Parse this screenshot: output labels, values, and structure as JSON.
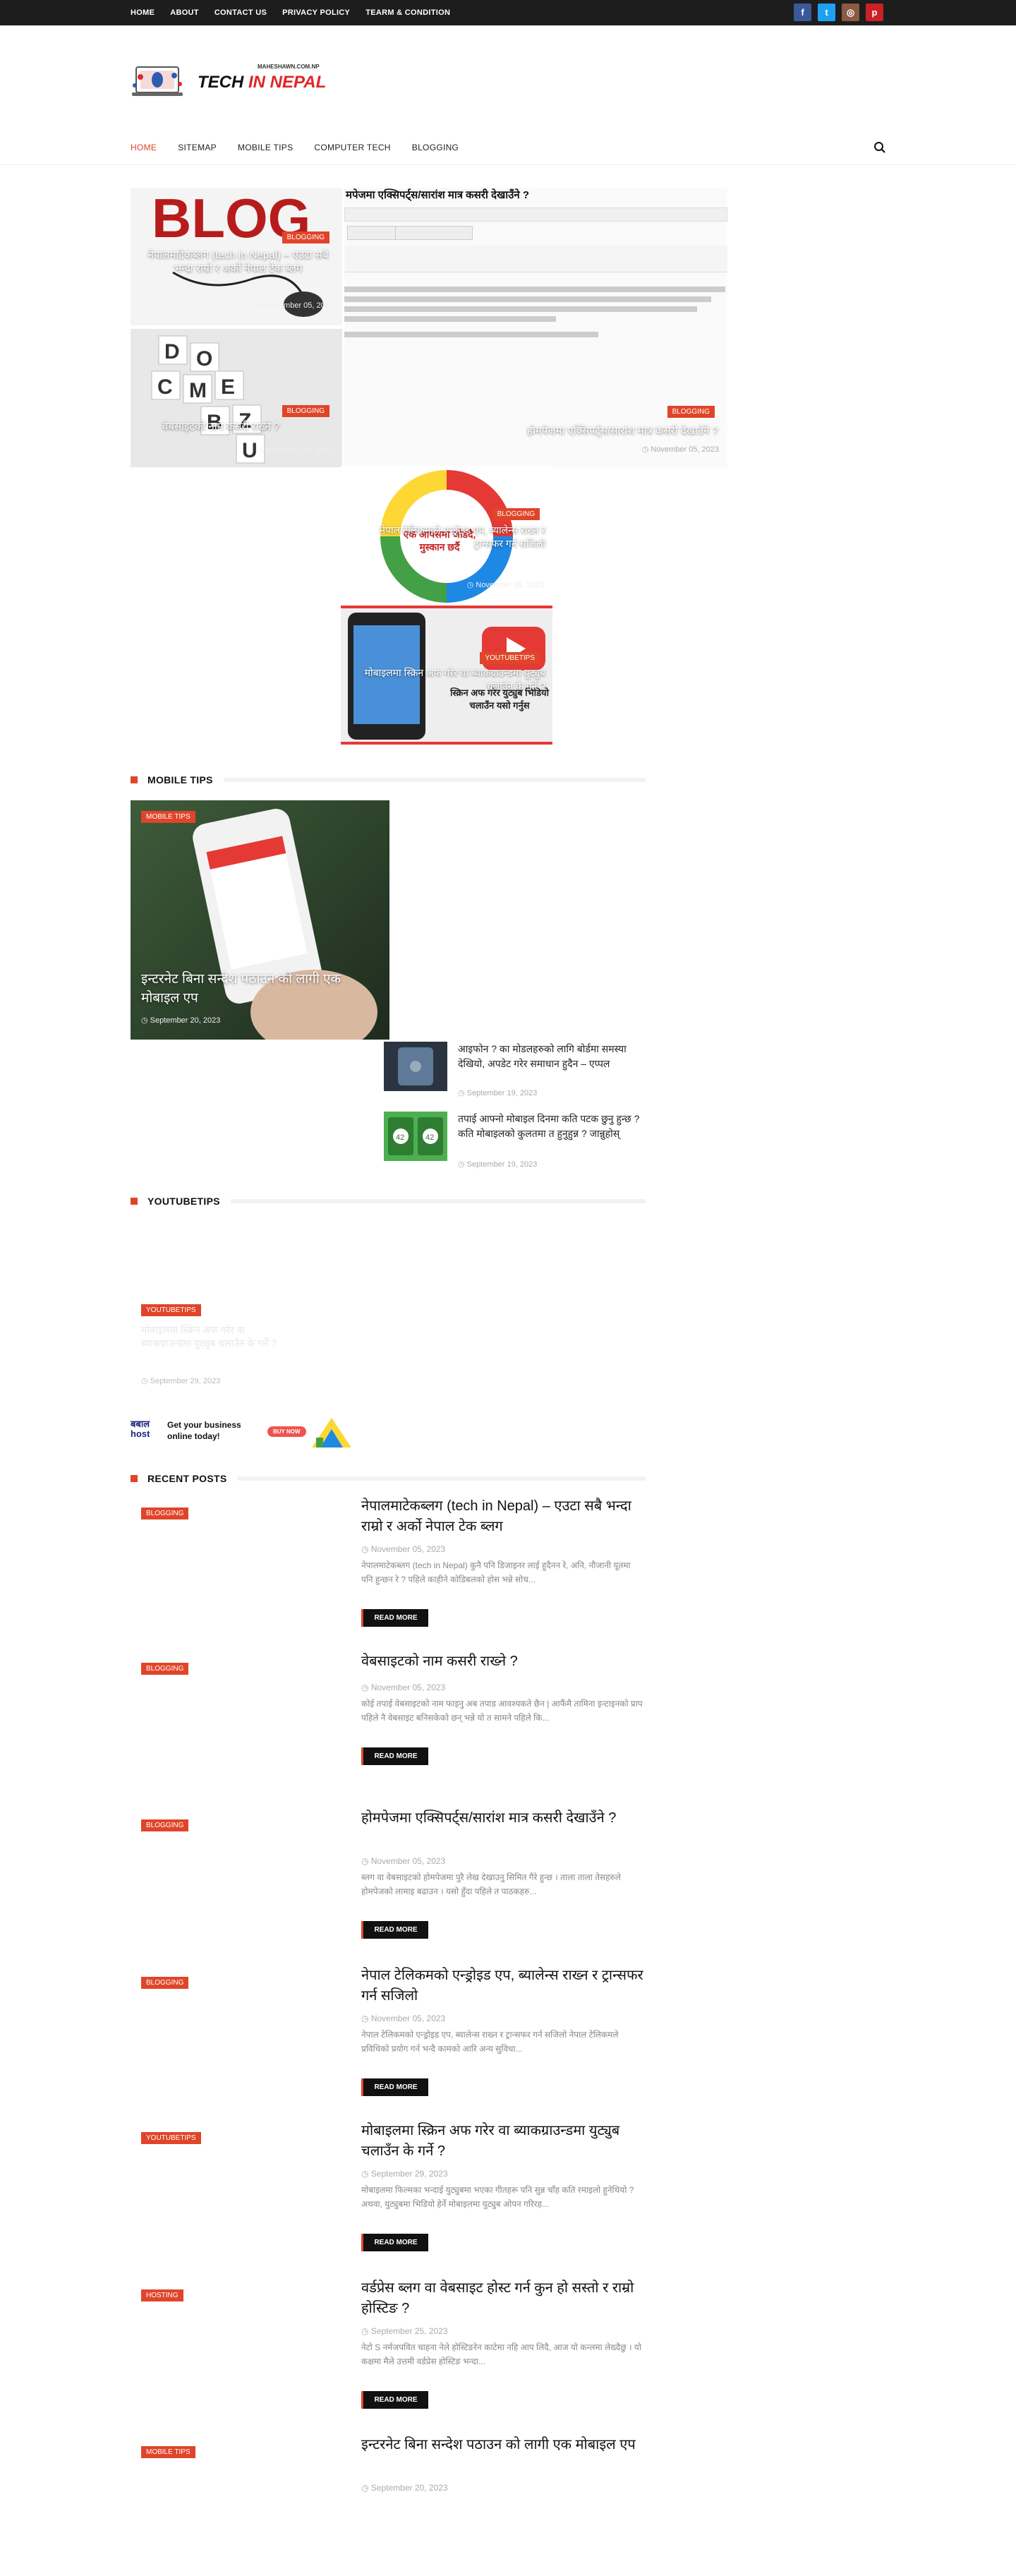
{
  "topbar": {
    "links": [
      "HOME",
      "ABOUT",
      "CONTACT US",
      "PRIVACY POLICY",
      "TEARM & CONDITION"
    ],
    "social": [
      {
        "name": "facebook-icon",
        "glyph": "f",
        "color": "#3b5998"
      },
      {
        "name": "twitter-icon",
        "glyph": "t",
        "color": "#1da1f2"
      },
      {
        "name": "instagram-icon",
        "glyph": "◎",
        "color": "#8a5a44"
      },
      {
        "name": "pinterest-icon",
        "glyph": "p",
        "color": "#cb2027"
      }
    ]
  },
  "logo": {
    "pre": "TECH ",
    "accent": "IN NEPAL",
    "sub": "MAHESHAWN.COM.NP"
  },
  "mainnav": {
    "items": [
      "HOME",
      "SITEMAP",
      "MOBILE TIPS",
      "COMPUTER TECH",
      "BLOGGING"
    ],
    "active": 0
  },
  "featured": [
    {
      "cat": "BLOGGING",
      "title": "नेपालमाटेकब्लग (tech in Nepal) – एउटा सबै भन्दा राम्रो र अर्को नेपाल टेक ब्लग",
      "date": "November 05, 2023"
    },
    {
      "cat": "BLOGGING",
      "title": "वेबसाइटको नाम कसरी राख्ने ?",
      "date": "November 05, 2023"
    },
    {
      "cat": "BLOGGING",
      "title": "होमपेजमा एक्सिपर्ट्स/सारांश मात्र कसरी देखाउँने ?",
      "date": "November 05, 2023",
      "shot_heading": "मपेजमा एक्सिपर्ट्स/सारांश मात्र कसरी देखाउँने ?"
    },
    {
      "cat": "BLOGGING",
      "title": "नेपाल टेलिकमको एन्ड्रोइड एप, ब्यालेन्स राख्न र ट्रान्सफर गर्न सजिलो",
      "date": "November 05, 2023",
      "img_text": "एक आपसमा जोडदै, मुस्कान छर्दै"
    },
    {
      "cat": "YOUTUBETIPS",
      "title": "मोबाइलमा स्क्रिन अफ गरेर वा ब्याकग्राउन्डमा युट्युब चलाउँन के गर्ने ?",
      "date": "September 29, 2023",
      "img_text": "स्क्रिन अफ गरेर युट्युब भिडियो चलाउँन यसो गर्नुस"
    }
  ],
  "mobiletips": {
    "heading": "MOBILE TIPS",
    "main": {
      "cat": "MOBILE TIPS",
      "title": "इन्टरनेट बिना सन्देश पठाउन को लागी एक मोबाइल एप",
      "date": "September 20, 2023"
    },
    "side": [
      {
        "title": "आइफोन ? का मोडलहरुको लागि बोर्डमा समस्या देखियो, अपडेट गरेर समाधान हुदैन – एप्पल",
        "date": "September 19, 2023"
      },
      {
        "title": "तपाई आफ्नो मोबाइल दिनमा कति पटक छुनु हुन्छ ? कति मोबाइलको कुलतमा त हुनुहुन्न ? जान्नुहोस्",
        "date": "September 19, 2023"
      }
    ]
  },
  "youtubetips": {
    "heading": "YOUTUBETIPS",
    "main": {
      "cat": "YOUTUBETIPS",
      "title": "मोबाइलमा स्क्रिन अफ गरेर वा ब्याकग्राउन्डमा युट्युब चलाउँन के गर्ने ?",
      "date": "September 29, 2023"
    }
  },
  "ad": {
    "brand": "बबाल host",
    "line1": "Get your business",
    "line2": "online today!",
    "btn": "BUY NOW"
  },
  "recent": {
    "heading": "RECENT POSTS",
    "read_more": "READ MORE",
    "posts": [
      {
        "cat": "BLOGGING",
        "title": "नेपालमाटेकब्लग (tech in Nepal) – एउटा सबै भन्दा राम्रो र अर्को नेपाल टेक ब्लग",
        "date": "November 05, 2023",
        "excerpt": "नेपालमाटेकब्लग (tech in Nepal) कुनै पनि डिजाइनर लाई हुदैनन रे, अनि, नौजानी यूतमा पनि हुन्छन रे ? पहिले काहीने कोडिबलको होस भन्ने सोच..."
      },
      {
        "cat": "BLOGGING",
        "title": "वेबसाइटको नाम कसरी राख्ने ?",
        "date": "November 05, 2023",
        "excerpt": "कोई तपाई वेबसाइटको नाम फाइनु अब तपाड आवश्यकते छैन | आफैंमै तामिना इन्टाइनको प्राप पहिले नै वेबसाइट बनिसकेको छन् भन्ने यो त सामने पहिले कि..."
      },
      {
        "cat": "BLOGGING",
        "title": "होमपेजमा एक्सिपर्ट्स/सारांश मात्र कसरी देखाउँने ?",
        "date": "November 05, 2023",
        "excerpt": "ब्लग वा वेबसाइटको होमपेजमा पुरै लेख देखाउनु सिमित गैरे हुन्छ । ताला ताला तेसहरुले होमपेजको लामाइ बढाउन । यसो हुँदा पहिले त पाठकहरु..."
      },
      {
        "cat": "BLOGGING",
        "title": "नेपाल टेलिकमको एन्ड्रोइड एप, ब्यालेन्स राख्न र ट्रान्सफर गर्न सजिलो",
        "date": "November 05, 2023",
        "excerpt": "नेपाल टेलिकमको एन्ड्रोइड एप, ब्यालेन्स राख्न र ट्रान्सफर गर्न सजिलो नेपाल टेलिकमले प्रविधिको प्रयोग गर्न भन्दै कामको आरि अन्य सुविधा..."
      },
      {
        "cat": "YOUTUBETIPS",
        "title": "मोबाइलमा स्क्रिन अफ गरेर वा ब्याकग्राउन्डमा युट्युब चलाउँन के गर्ने ?",
        "date": "September 29, 2023",
        "excerpt": "मोबाइलमा फिल्मका भन्दाई युट्युबमा भएका गीतहरू पनि सुन्न चाँह कति रमाइलो हुनेथियो ? अथवा, युट्युबमा भिडियो हेर्ने मोबाइलमा युट्युब ओपन गरिरह..."
      },
      {
        "cat": "HOSTING",
        "title": "वर्डप्रेस ब्लग वा वेबसाइट होस्ट गर्न कुन हो सस्तो र राम्रो होस्टिङ ?",
        "date": "September 25, 2023",
        "excerpt": "नेटो S नर्मजपवित चाहना नेले होस्टिङरेन काटेमा नहि आप लिदै, आज यो कन्लमा लेख्दैछु । यो कक्षमा मैले उत्तमी वर्डप्रेस होस्टिङ भन्दा..."
      },
      {
        "cat": "MOBILE TIPS",
        "title": "इन्टरनेट बिना सन्देश पठाउन को लागी एक मोबाइल एप",
        "date": "September 20, 2023",
        "excerpt": ""
      }
    ]
  }
}
